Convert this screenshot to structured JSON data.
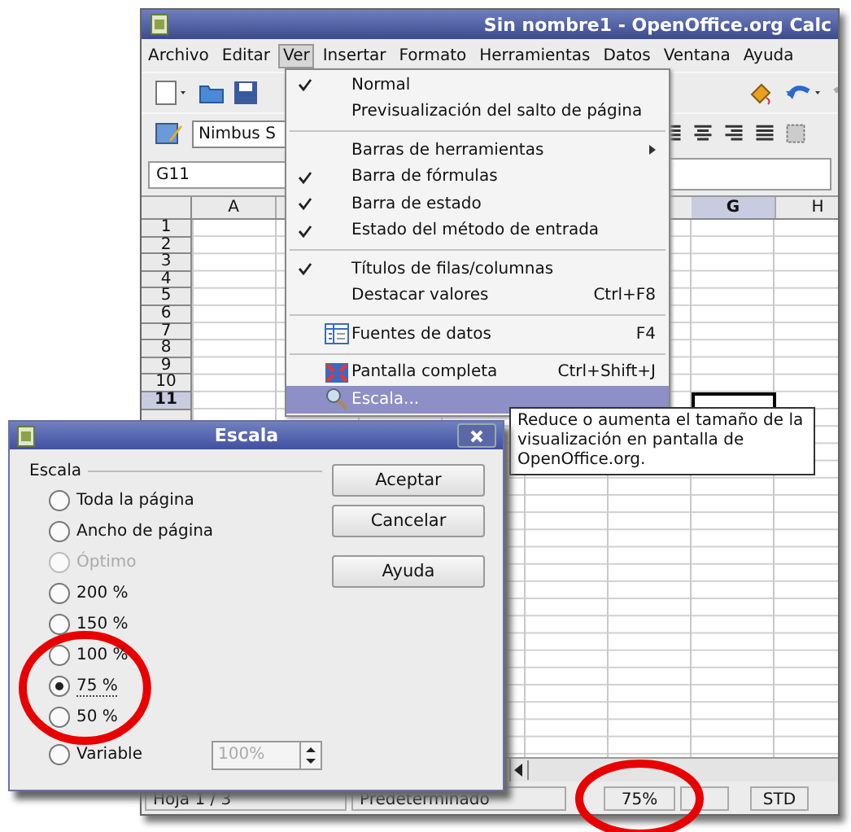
{
  "window": {
    "title": "Sin nombre1 - OpenOffice.org Calc"
  },
  "menubar": [
    {
      "label": "Archivo",
      "selected": false
    },
    {
      "label": "Editar",
      "selected": false
    },
    {
      "label": "Ver",
      "selected": true
    },
    {
      "label": "Insertar",
      "selected": false
    },
    {
      "label": "Formato",
      "selected": false
    },
    {
      "label": "Herramientas",
      "selected": false
    },
    {
      "label": "Datos",
      "selected": false
    },
    {
      "label": "Ventana",
      "selected": false
    },
    {
      "label": "Ayuda",
      "selected": false
    }
  ],
  "font_box": {
    "value": "Nimbus S"
  },
  "name_box": {
    "value": "G11"
  },
  "sheet": {
    "columns": [
      {
        "label": "A",
        "selected": false
      },
      {
        "label": "G",
        "selected": true
      },
      {
        "label": "H",
        "selected": false
      }
    ],
    "rows": [
      {
        "label": "1",
        "selected": false
      },
      {
        "label": "2",
        "selected": false
      },
      {
        "label": "3",
        "selected": false
      },
      {
        "label": "4",
        "selected": false
      },
      {
        "label": "5",
        "selected": false
      },
      {
        "label": "6",
        "selected": false
      },
      {
        "label": "7",
        "selected": false
      },
      {
        "label": "8",
        "selected": false
      },
      {
        "label": "9",
        "selected": false
      },
      {
        "label": "10",
        "selected": false
      },
      {
        "label": "11",
        "selected": true
      }
    ]
  },
  "status_bar": [
    {
      "kind": "sheet",
      "text": "Hoja 1 / 3",
      "highlighted": false
    },
    {
      "kind": "style",
      "text": "Predeterminado",
      "highlighted": false
    },
    {
      "kind": "zoom",
      "text": "75%",
      "highlighted": true
    },
    {
      "kind": "blank",
      "highlighted": false
    },
    {
      "kind": "mode",
      "text": "STD",
      "highlighted": false
    }
  ],
  "menu": {
    "items": [
      {
        "kind": "plain",
        "label": "Normal",
        "checked": true,
        "selected": false
      },
      {
        "kind": "plain",
        "label": "Previsualización del salto de página",
        "checked": false,
        "selected": false
      },
      {
        "kind": "separator"
      },
      {
        "kind": "plain",
        "label": "Barras de herramientas",
        "checked": false,
        "submenu": true,
        "selected": false
      },
      {
        "kind": "plain",
        "label": "Barra de fórmulas",
        "checked": true,
        "selected": false
      },
      {
        "kind": "plain",
        "label": "Barra de estado",
        "checked": true,
        "selected": false
      },
      {
        "kind": "plain",
        "label": "Estado del método de entrada",
        "checked": true,
        "selected": false
      },
      {
        "kind": "separator"
      },
      {
        "kind": "plain",
        "label": "Títulos de filas/columnas",
        "checked": true,
        "selected": false
      },
      {
        "kind": "plain",
        "label": "Destacar valores",
        "checked": false,
        "shortcut": "Ctrl+F8",
        "selected": false
      },
      {
        "kind": "separator"
      },
      {
        "kind": "datasource",
        "label": "Fuentes de datos",
        "checked": false,
        "shortcut": "F4",
        "selected": false
      },
      {
        "kind": "separator"
      },
      {
        "kind": "fullscreen",
        "label": "Pantalla completa",
        "checked": false,
        "shortcut": "Ctrl+Shift+J",
        "selected": false
      },
      {
        "kind": "zoom",
        "label": "Escala...",
        "checked": false,
        "selected": true
      }
    ]
  },
  "tooltip": {
    "text": "Reduce o aumenta el tamaño de la visualización en pantalla de OpenOffice.org."
  },
  "dialog": {
    "title": "Escala",
    "group_label": "Escala",
    "options": [
      {
        "label": "Toda la página",
        "selected": false,
        "disabled": false,
        "highlighted": false
      },
      {
        "label": "Ancho de página",
        "selected": false,
        "disabled": false,
        "highlighted": false
      },
      {
        "label": "Óptimo",
        "selected": false,
        "disabled": true,
        "highlighted": false
      },
      {
        "label": "200 %",
        "selected": false,
        "disabled": false,
        "highlighted": false
      },
      {
        "label": "150 %",
        "selected": false,
        "disabled": false,
        "highlighted": false
      },
      {
        "label": "100 %",
        "selected": false,
        "disabled": false,
        "highlighted": false
      },
      {
        "label": "75 %",
        "selected": true,
        "disabled": false,
        "highlighted": true
      },
      {
        "label": "50 %",
        "selected": false,
        "disabled": false,
        "highlighted": false
      }
    ],
    "variable": {
      "label": "Variable",
      "selected": false,
      "value": "100%",
      "disabled": true
    },
    "buttons": [
      "Aceptar",
      "Cancelar",
      "Ayuda"
    ]
  }
}
